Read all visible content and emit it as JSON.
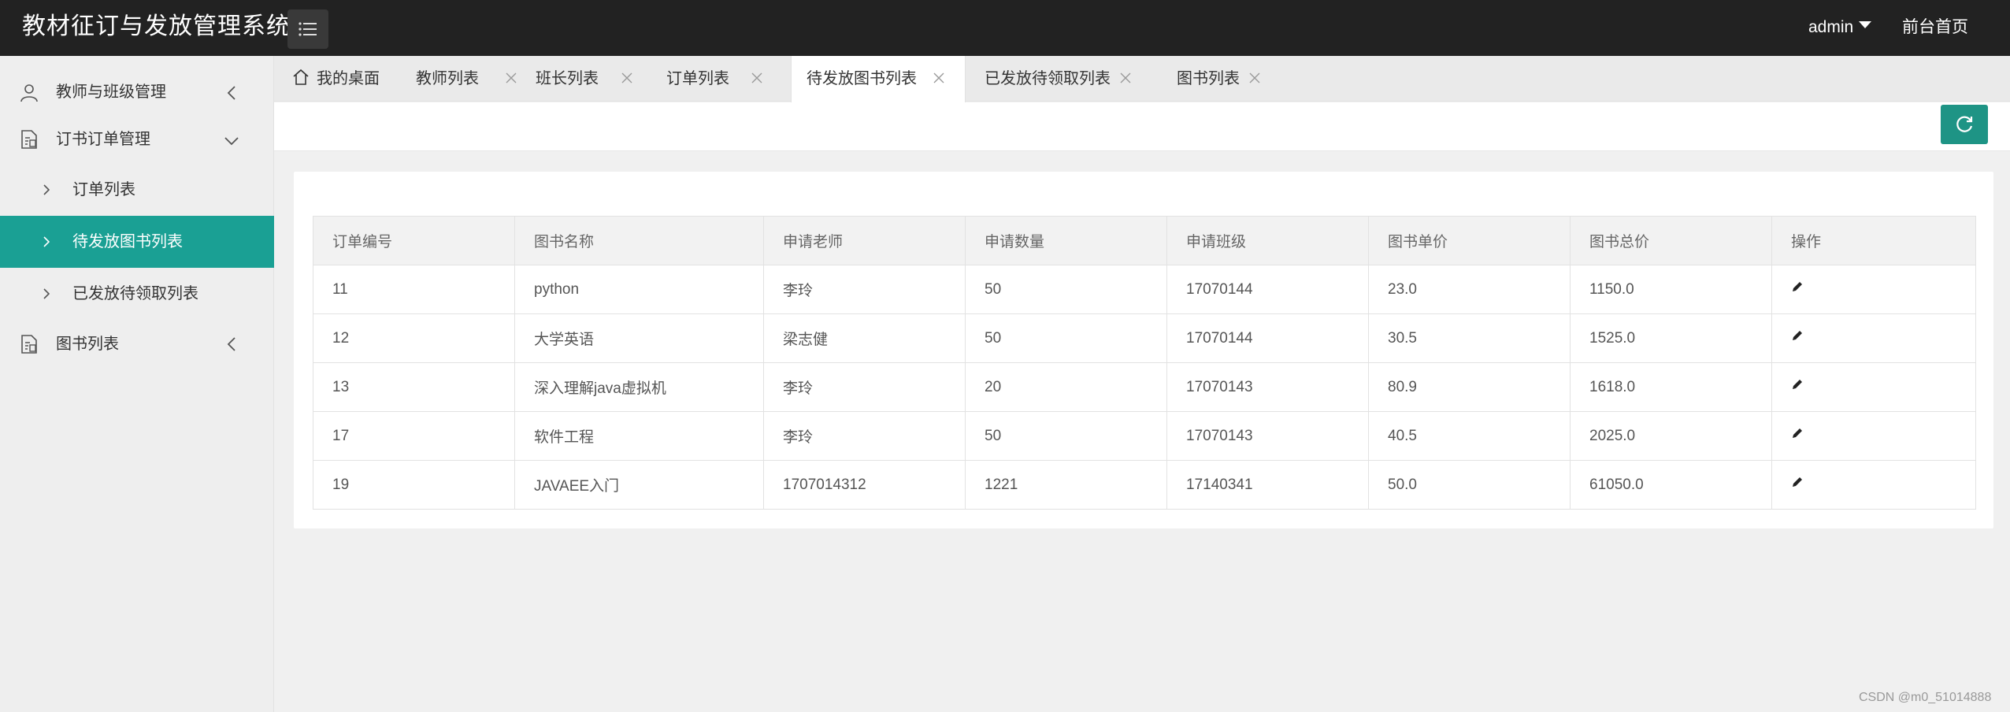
{
  "header": {
    "app_title": "教材征订与发放管理系统",
    "user_menu_label": "admin",
    "home_link_label": "前台首页"
  },
  "sidebar": {
    "items": [
      {
        "label": "教师与班级管理",
        "icon": "user-icon"
      },
      {
        "label": "订书订单管理",
        "icon": "document-icon"
      },
      {
        "label": "订单列表"
      },
      {
        "label": "待发放图书列表",
        "active": true
      },
      {
        "label": "已发放待领取列表"
      },
      {
        "label": "图书列表",
        "icon": "document-icon"
      }
    ]
  },
  "tabs": [
    {
      "label": "我的桌面",
      "icon": "home-icon"
    },
    {
      "label": "教师列表"
    },
    {
      "label": "班长列表"
    },
    {
      "label": "订单列表"
    },
    {
      "label": "待发放图书列表",
      "active": true
    },
    {
      "label": "已发放待领取列表"
    },
    {
      "label": "图书列表"
    }
  ],
  "table": {
    "columns": [
      "订单编号",
      "图书名称",
      "申请老师",
      "申请数量",
      "申请班级",
      "图书单价",
      "图书总价",
      "操作"
    ],
    "rows": [
      [
        "11",
        "python",
        "李玲",
        "50",
        "17070144",
        "23.0",
        "1150.0"
      ],
      [
        "12",
        "大学英语",
        "梁志健",
        "50",
        "17070144",
        "30.5",
        "1525.0"
      ],
      [
        "13",
        "深入理解java虚拟机",
        "李玲",
        "20",
        "17070143",
        "80.9",
        "1618.0"
      ],
      [
        "17",
        "软件工程",
        "李玲",
        "50",
        "17070143",
        "40.5",
        "2025.0"
      ],
      [
        "19",
        "JAVAEE入门",
        "1707014312",
        "1221",
        "17140341",
        "50.0",
        "61050.0"
      ]
    ]
  },
  "watermark": "CSDN @m0_51014888",
  "colors": {
    "header_bg": "#222222",
    "accent": "#1aa094",
    "refresh_button": "#1e9485"
  }
}
